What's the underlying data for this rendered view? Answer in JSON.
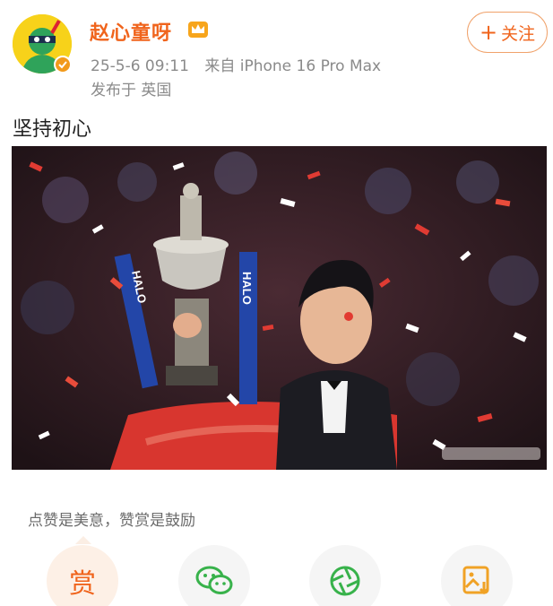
{
  "header": {
    "username": "赵心童呀",
    "timestamp": "25-5-6 09:11",
    "source": "来自 iPhone 16 Pro Max",
    "location": "发布于 英国",
    "follow_label": "关注",
    "follow_plus": "+"
  },
  "post": {
    "text": "坚持初心",
    "photo_banner_left": "HALO",
    "photo_banner_right": "HALO"
  },
  "reward": {
    "caption": "点赞是美意，赞赏是鼓励",
    "reward_label": "赏"
  },
  "icons": {
    "crown": "crown-icon",
    "verified": "verified-badge-icon",
    "wechat": "wechat-icon",
    "moments": "moments-icon",
    "save": "save-image-icon"
  },
  "colors": {
    "accent": "#f0641c",
    "meta_text": "#8a8a8a",
    "icon_green": "#38b24b",
    "save_orange": "#f0a226"
  }
}
